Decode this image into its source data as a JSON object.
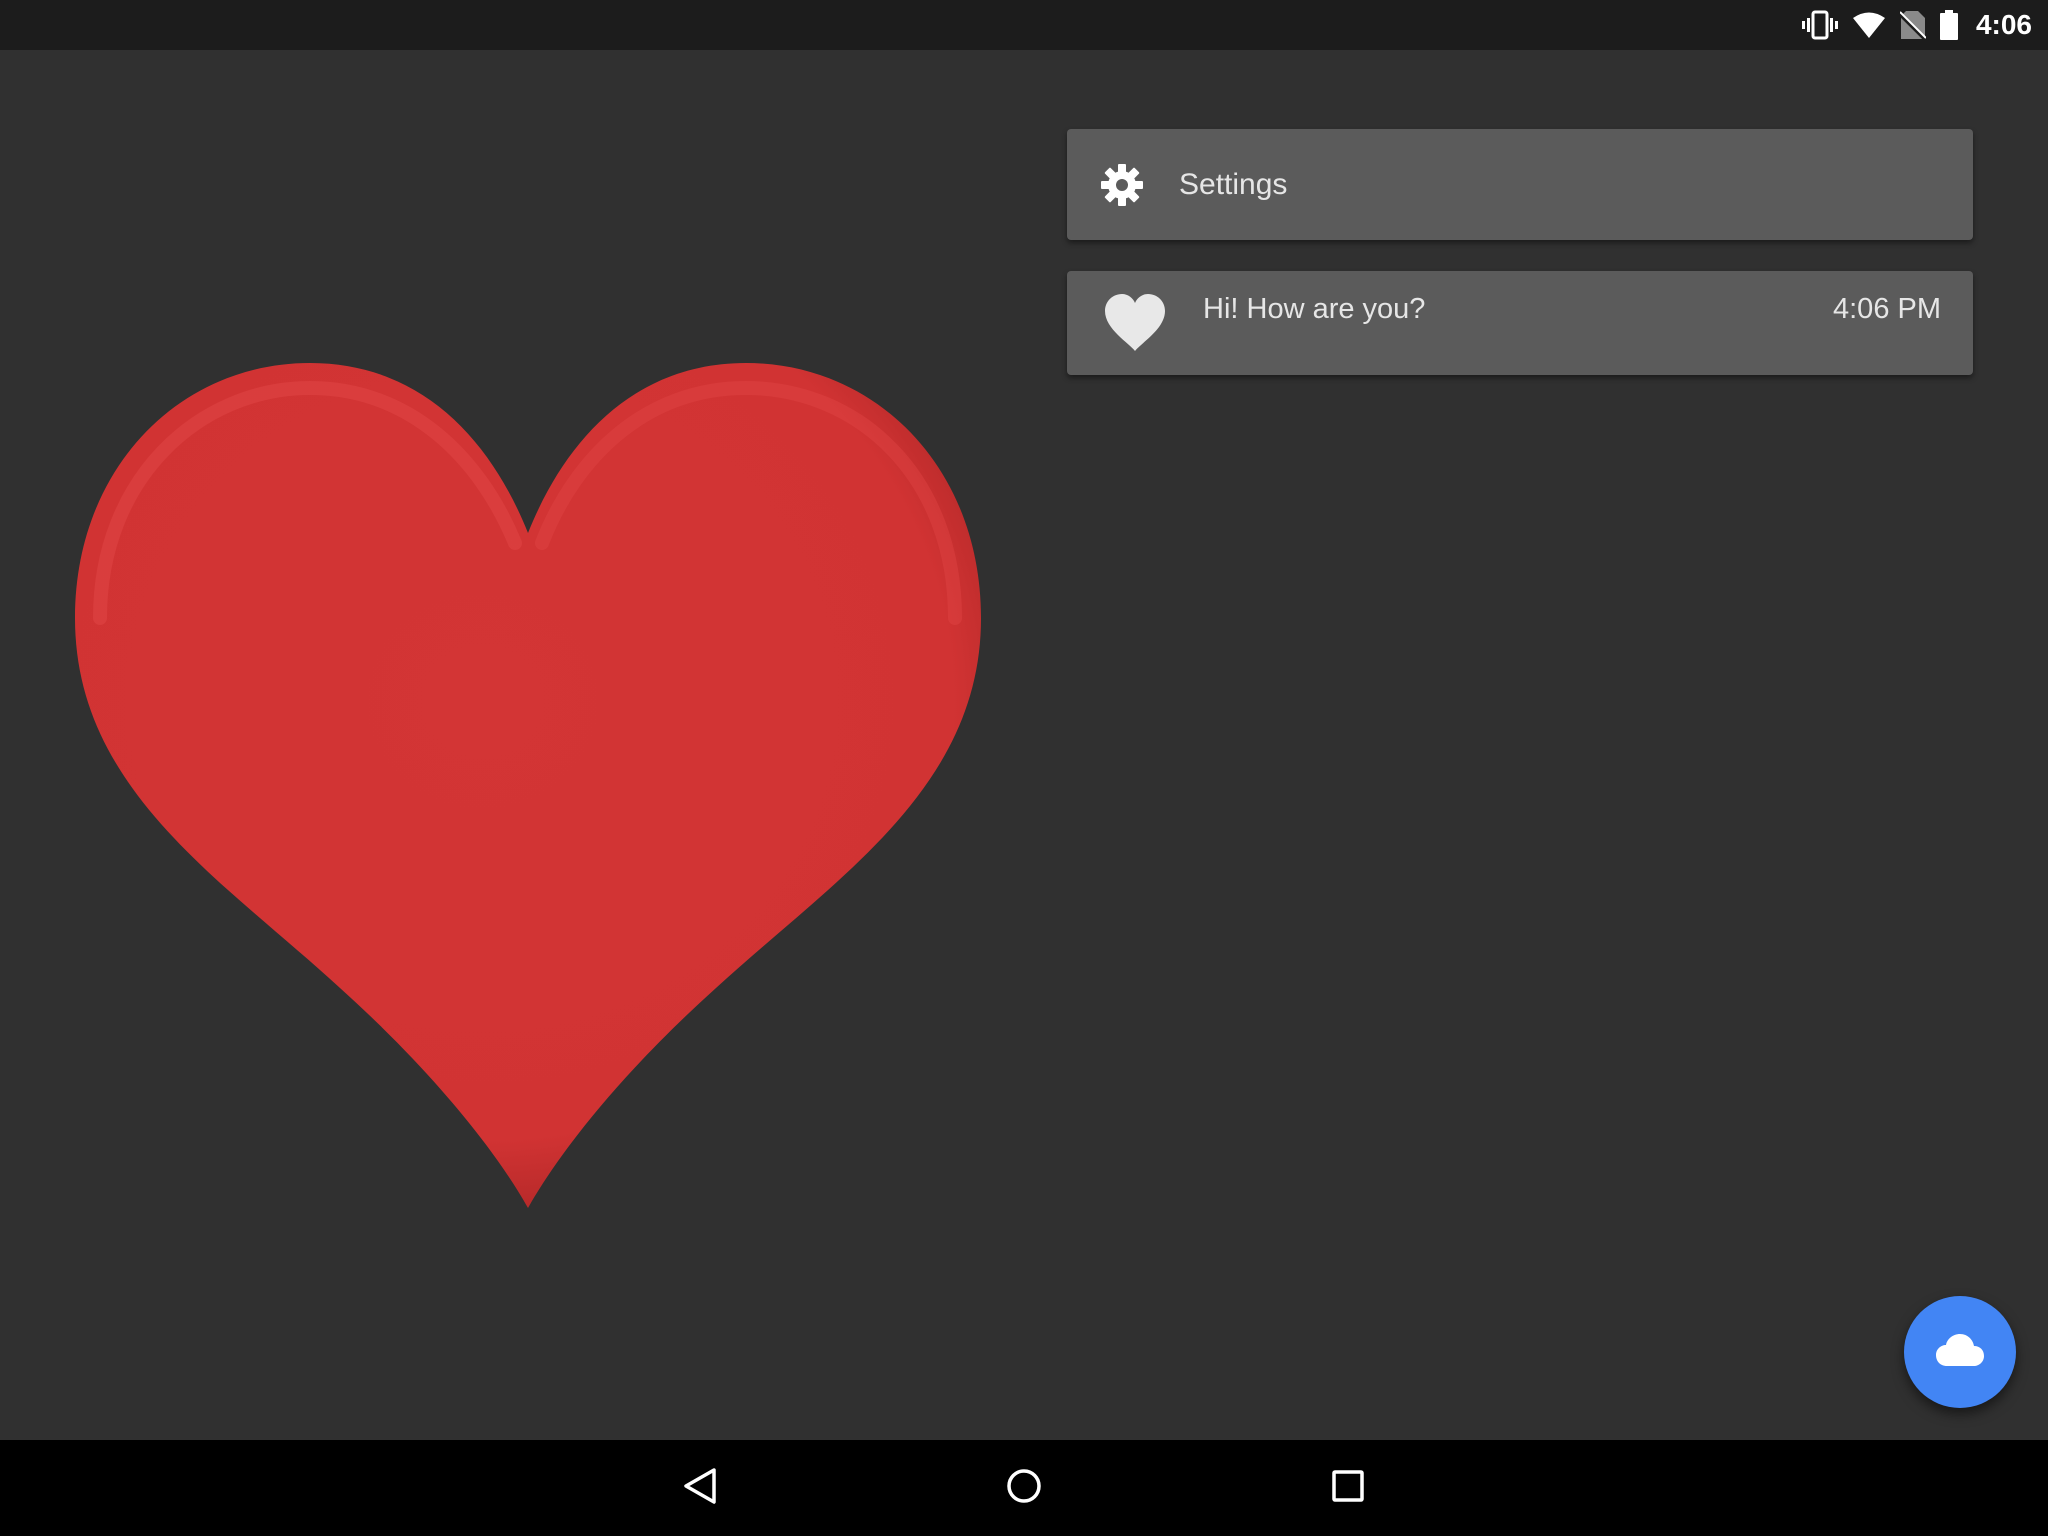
{
  "status_bar": {
    "time": "4:06",
    "icons": [
      "vibrate-icon",
      "wifi-icon",
      "no-sim-icon",
      "battery-icon"
    ]
  },
  "main": {
    "hero_image": "red-heart-illustration",
    "settings_card": {
      "icon": "gear-icon",
      "label": "Settings"
    },
    "message_card": {
      "icon": "heart-icon",
      "text": "Hi! How are you?",
      "time": "4:06 PM"
    },
    "fab": {
      "icon": "cloud-icon",
      "color": "#4285f4"
    }
  },
  "nav_bar": {
    "buttons": [
      "back-icon",
      "home-icon",
      "recents-icon"
    ]
  },
  "colors": {
    "background": "#303030",
    "card": "#5b5b5b",
    "heart": "#d23434",
    "status_bar": "#1c1c1c",
    "nav_bar": "#000000"
  }
}
